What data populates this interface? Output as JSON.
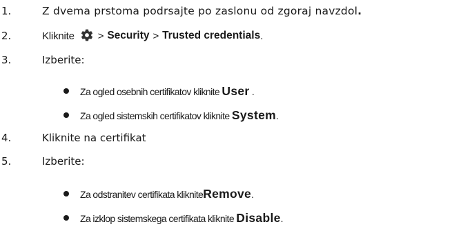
{
  "steps": [
    {
      "num": "1.",
      "text": "Z dvema prstoma podrsajte po zaslonu od zgoraj navzdol",
      "end": "."
    },
    {
      "num": "2.",
      "prefix": "Kliknite",
      "icon": "gear-icon",
      "sep1": ">",
      "path1": "Security",
      "sep2": ">",
      "path2": "Trusted credentials",
      "end": "."
    },
    {
      "num": "3.",
      "text": "Izberite:"
    },
    {
      "num": "4.",
      "text": "Kliknite na certifikat"
    },
    {
      "num": "5.",
      "text": "Izberite:"
    }
  ],
  "bullets_step3": [
    {
      "text": "Za ogled osebnih certifikatov kliknite",
      "bold": "User",
      "end": " ."
    },
    {
      "text": "Za ogled sistemskih certifikatov kliknite",
      "bold": "System",
      "end": "."
    }
  ],
  "bullets_step5": [
    {
      "text": "Za odstranitev certifikata kliknite",
      "bold": "Remove",
      "end": "."
    },
    {
      "text": "Za izklop sistemskega certifikata kliknite",
      "bold": "Disable",
      "end": "."
    }
  ]
}
